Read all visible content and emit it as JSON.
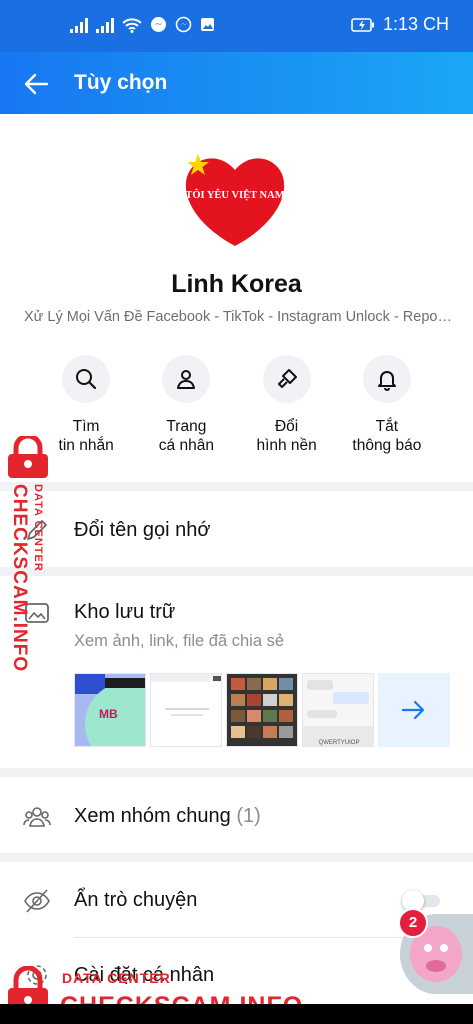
{
  "status_bar": {
    "time": "1:13 CH",
    "icons": [
      "signal-icon",
      "signal-icon",
      "wifi-icon",
      "messenger-icon",
      "messenger-icon",
      "image-icon",
      "battery-charging-icon"
    ]
  },
  "app_bar": {
    "title": "Tùy chọn",
    "back_icon": "arrow-left-icon"
  },
  "profile": {
    "avatar_text": "TÔI YÊU VIỆT NAM",
    "name": "Linh Korea",
    "bio": "Xử Lý Mọi Vấn Đề Facebook - TikTok - Instagram Unlock - Report - Lấy Lại Tài Khoản"
  },
  "actions": [
    {
      "line1": "Tìm",
      "line2": "tin nhắn",
      "icon": "search-icon"
    },
    {
      "line1": "Trang",
      "line2": "cá nhân",
      "icon": "person-icon"
    },
    {
      "line1": "Đổi",
      "line2": "hình nền",
      "icon": "paintbrush-icon"
    },
    {
      "line1": "Tắt",
      "line2": "thông báo",
      "icon": "bell-icon"
    }
  ],
  "menu": {
    "nickname": "Đổi tên gọi nhớ",
    "storage_title": "Kho lưu trữ",
    "storage_sub": "Xem ảnh, link, file đã chia sẻ",
    "groups": "Xem nhóm chung",
    "groups_count": "(1)",
    "hide_chat": "Ẩn trò chuyện",
    "personal_settings": "Cài đặt cá nhân"
  },
  "thumbnails": {
    "thumb1_label": "MB",
    "thumb4_label": "QWERTYUIOP"
  },
  "hide_chat_toggle_on": false,
  "chat_head": {
    "badge": "2"
  },
  "watermark": {
    "brand": "CHECKSCAM.INFO",
    "tag": "DATA CENTER"
  },
  "colors": {
    "primary": "#1877f2",
    "watermark": "#e3262e",
    "badge": "#e41e3f"
  }
}
